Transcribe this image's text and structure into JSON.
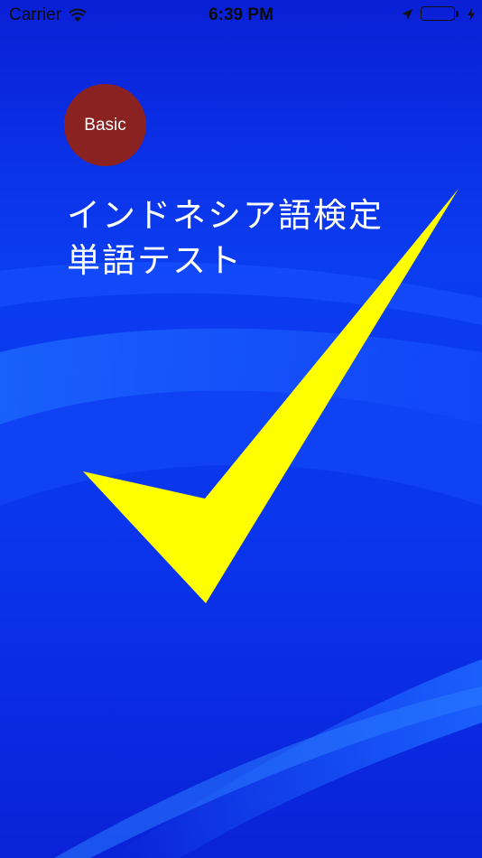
{
  "status_bar": {
    "carrier": "Carrier",
    "time": "6:39 PM",
    "battery_level": 1.0,
    "icons": [
      "wifi-icon",
      "location-arrow-icon",
      "battery-icon",
      "charging-bolt-icon"
    ]
  },
  "badge": {
    "label": "Basic",
    "color": "#8b2222"
  },
  "title": {
    "line1": "インドネシア語検定",
    "line2": "単語テスト"
  },
  "colors": {
    "background": "#0a2ee0",
    "checkmark": "#ffff00",
    "text": "#ffffff"
  }
}
